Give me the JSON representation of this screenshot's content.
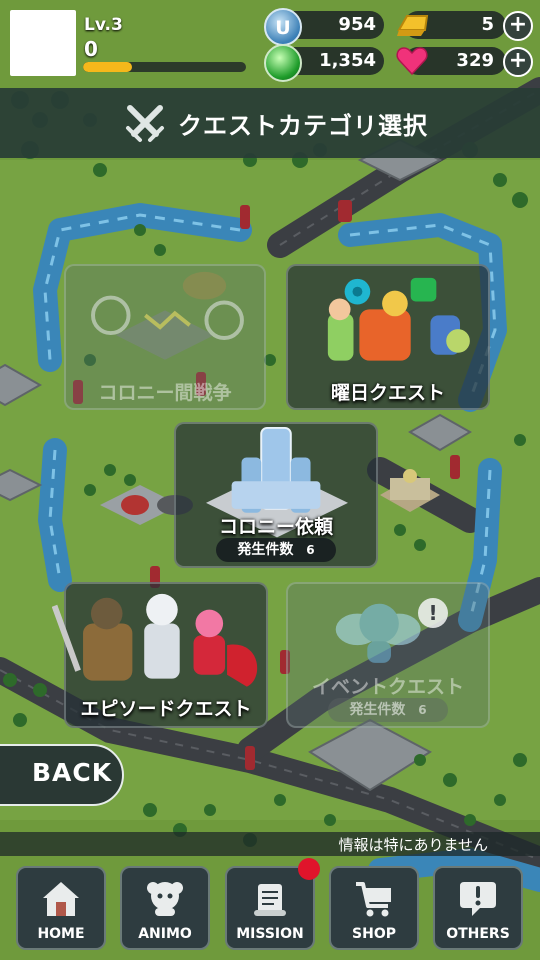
{
  "player": {
    "level_label": "Lv.3",
    "exp_value": "0",
    "exp_progress": 0.3
  },
  "currencies": [
    {
      "name": "u-coin",
      "icon": "u-coin-icon",
      "value": "954"
    },
    {
      "name": "gold-bar",
      "icon": "gold-bar-icon",
      "value": "5",
      "has_plus": true
    },
    {
      "name": "green-gem",
      "icon": "green-gem-icon",
      "value": "1,354"
    },
    {
      "name": "heart",
      "icon": "heart-icon",
      "value": "329",
      "has_plus": true
    }
  ],
  "title": "クエストカテゴリ選択",
  "quests": {
    "colony_war": {
      "label": "コロニー間戦争",
      "enabled": false
    },
    "weekday": {
      "label": "曜日クエスト",
      "enabled": true
    },
    "colony_request": {
      "label": "コロニー依頼",
      "count_label": "発生件数",
      "count": "6",
      "enabled": true
    },
    "episode": {
      "label": "エピソードクエスト",
      "enabled": true
    },
    "event": {
      "label": "イベントクエスト",
      "count_label": "発生件数",
      "count": "6",
      "enabled": false,
      "alert_icon": "exclamation-icon"
    }
  },
  "back_label": "BACK",
  "info_text": "情報は特にありません",
  "nav": [
    {
      "id": "home",
      "label": "HOME",
      "icon": "home-icon"
    },
    {
      "id": "animo",
      "label": "ANIMO",
      "icon": "animo-icon"
    },
    {
      "id": "mission",
      "label": "MISSION",
      "icon": "mission-scroll-icon",
      "badge": true
    },
    {
      "id": "shop",
      "label": "SHOP",
      "icon": "cart-icon"
    },
    {
      "id": "others",
      "label": "OTHERS",
      "icon": "exclamation-bubble-icon"
    }
  ],
  "colors": {
    "map_grass": "#6f9a3c",
    "river": "#3a86b8",
    "road": "#3c3f44",
    "xp_fill": "#f5b81b",
    "badge": "#e0142b"
  }
}
